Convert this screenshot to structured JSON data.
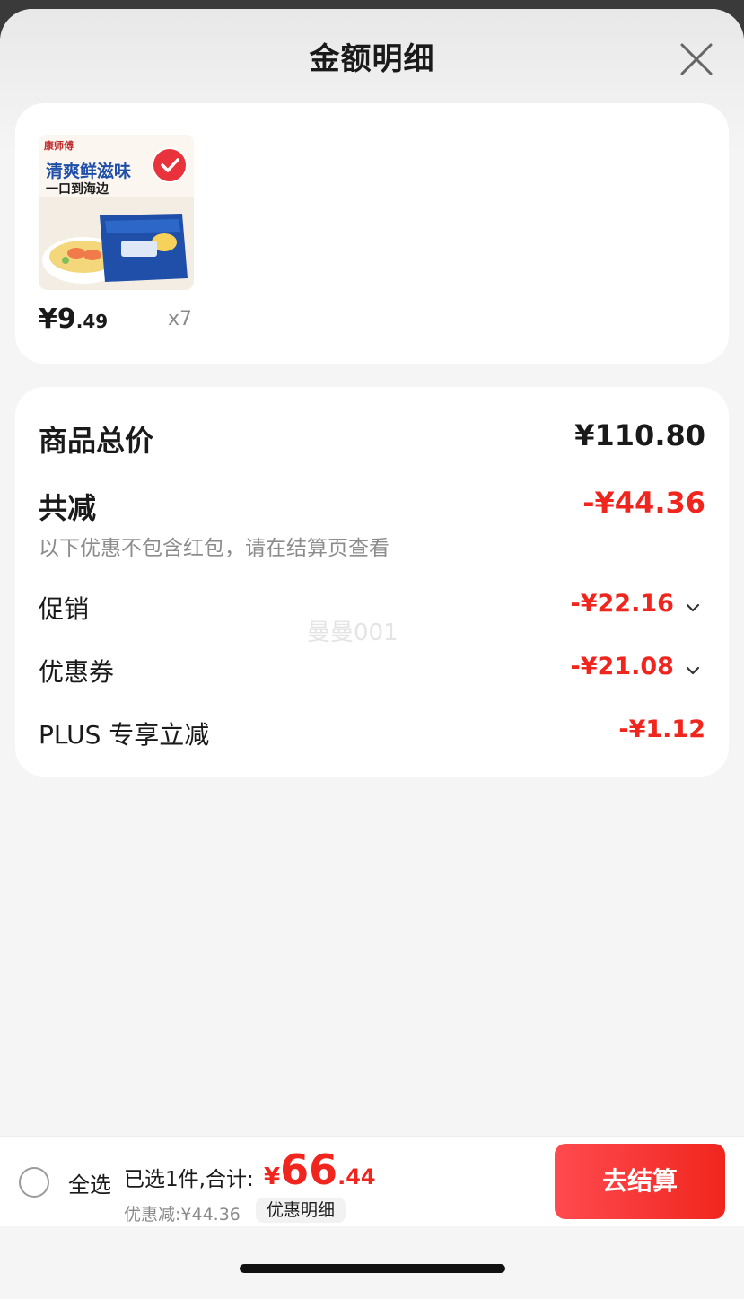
{
  "header": {
    "title": "金额明细"
  },
  "product": {
    "image_text": {
      "brand": "康师傅",
      "headline": "清爽鲜滋味",
      "subline": "一口到海边"
    },
    "price_currency": "¥",
    "price_int": "9",
    "price_cents": ".49",
    "quantity": "x7"
  },
  "summary": {
    "total_label": "商品总价",
    "total_value": "¥110.80",
    "reduce_label": "共减",
    "reduce_value": "-¥44.36",
    "note": "以下优惠不包含红包，请在结算页查看",
    "promo_label": "促销",
    "promo_value": "-¥22.16",
    "coupon_label": "优惠券",
    "coupon_value": "-¥21.08",
    "plus_label": "PLUS 专享立减",
    "plus_value": "-¥1.12"
  },
  "watermark": "曼曼001",
  "bottom": {
    "select_all": "全选",
    "selected_text": "已选1件,合计:",
    "total_currency": "¥",
    "total_int": "66",
    "total_cents": ".44",
    "discount_line": "优惠减:¥44.36",
    "detail_button": "优惠明细",
    "checkout_button": "去结算"
  },
  "colors": {
    "accent_red": "#f0261e",
    "background": "#f5f5f5",
    "card": "#ffffff"
  }
}
